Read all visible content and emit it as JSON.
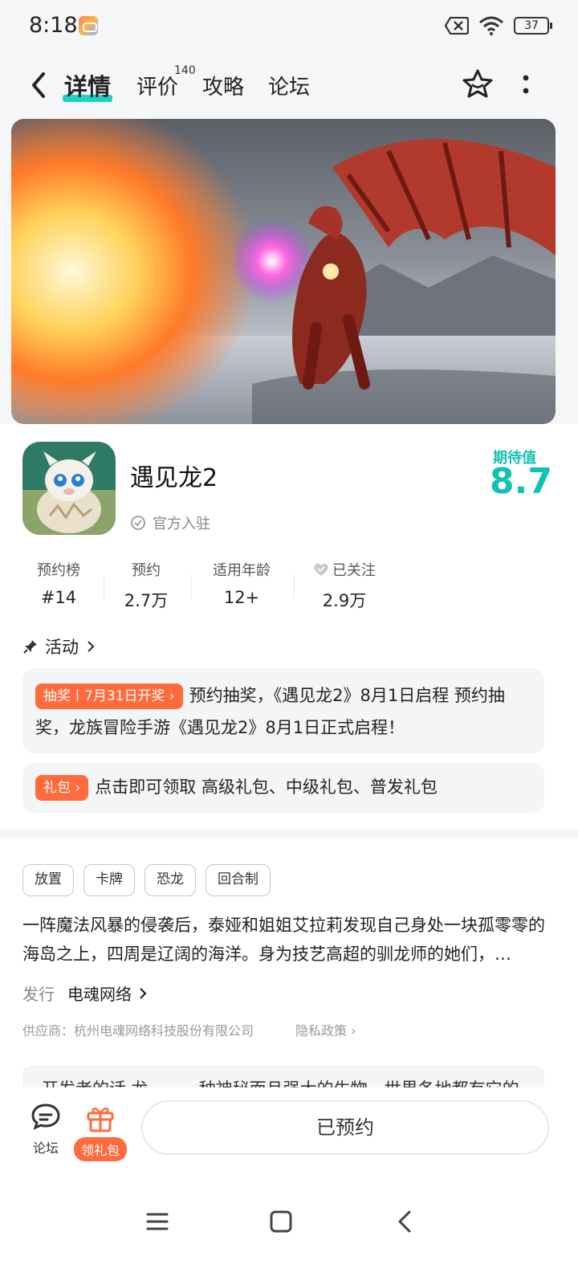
{
  "status_bar": {
    "time": "8:18",
    "battery": "37"
  },
  "nav": {
    "tabs": [
      {
        "label": "详情",
        "active": true
      },
      {
        "label": "评价",
        "badge": "140"
      },
      {
        "label": "攻略"
      },
      {
        "label": "论坛"
      }
    ]
  },
  "app": {
    "name": "遇见龙2",
    "official_label": "官方入驻",
    "score_label": "期待值",
    "score_value": "8.7"
  },
  "stats": [
    {
      "label": "预约榜",
      "value": "#14"
    },
    {
      "label": "预约",
      "value": "2.7万"
    },
    {
      "label": "适用年龄",
      "value": "12+"
    },
    {
      "label": "已关注",
      "value": "2.9万"
    }
  ],
  "activity": {
    "title": "活动",
    "items": [
      {
        "tag": "抽奖丨7月31日开奖 ›",
        "text": "预约抽奖，《遇见龙2》8月1日启程 预约抽奖，龙族冒险手游《遇见龙2》8月1日正式启程！"
      },
      {
        "tag": "礼包 ›",
        "text": "点击即可领取 高级礼包、中级礼包、普发礼包"
      }
    ]
  },
  "tags": [
    "放置",
    "卡牌",
    "恐龙",
    "回合制"
  ],
  "description": "一阵魔法风暴的侵袭后，泰娅和姐姐艾拉莉发现自己身处一块孤零零的海岛之上，四周是辽阔的海洋。身为技艺高超的驯龙师的她们，…",
  "publisher": {
    "label": "发行",
    "name": "电魂网络"
  },
  "supplier": "供应商：杭州电魂网络科技股份有限公司",
  "privacy": "隐私政策",
  "developer_note": "开发者的话  龙——一种神秘而且强大的生物，世界各地都有它的",
  "bottom_bar": {
    "forum_label": "论坛",
    "gift_label": "领礼包",
    "reserve_label": "已预约"
  },
  "colors": {
    "accent": "#12c1b3",
    "orange": "#ff6b3d"
  }
}
